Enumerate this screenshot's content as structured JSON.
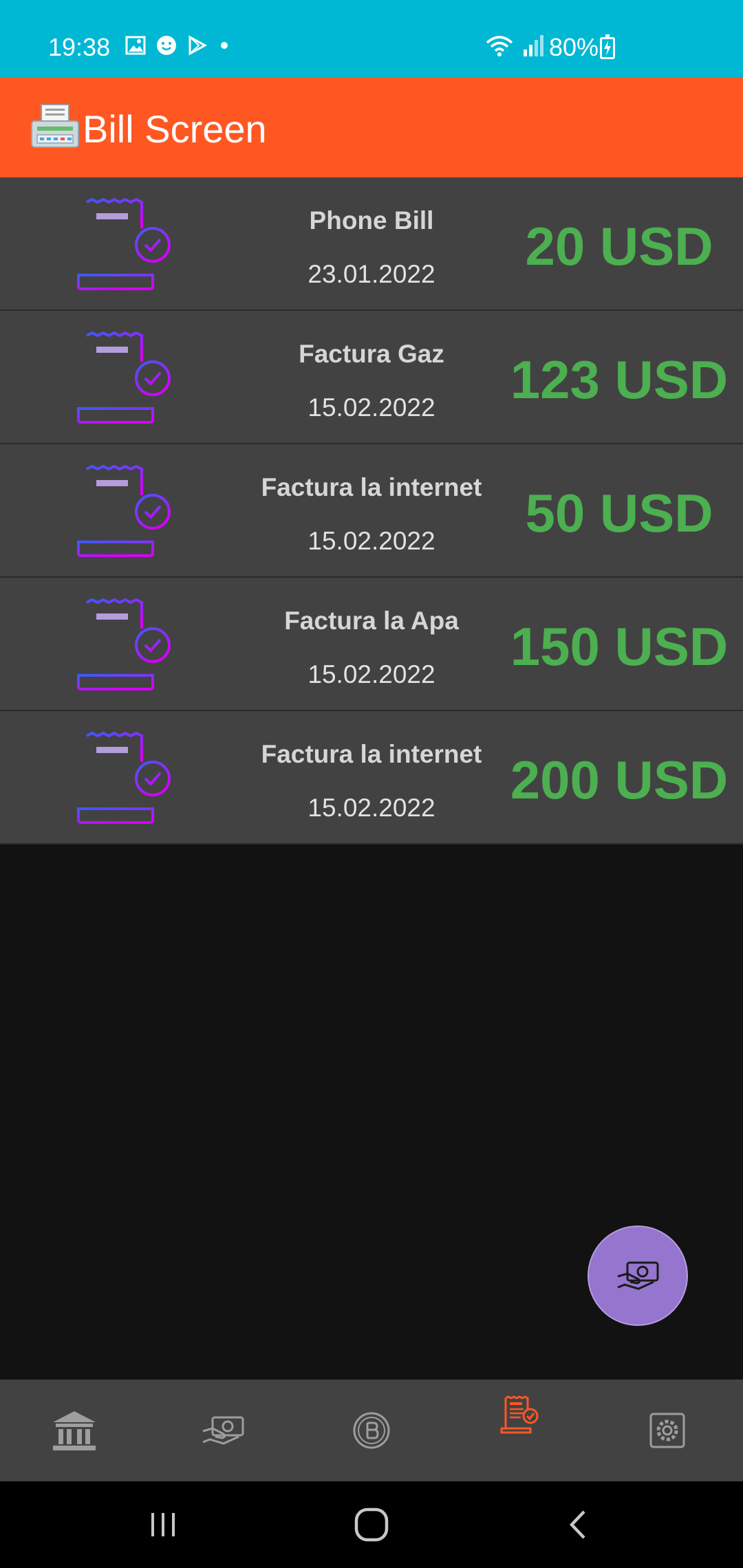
{
  "status_bar": {
    "time": "19:38",
    "battery": "80%",
    "icons": [
      "image-icon",
      "face-icon",
      "play-store-icon",
      "dot-icon",
      "wifi-icon",
      "signal-icon",
      "battery-charging-icon"
    ]
  },
  "app_bar": {
    "title": "Bill Screen",
    "icon": "printer-icon",
    "color": "#FF5722"
  },
  "bills": [
    {
      "name": "Phone Bill",
      "date": "23.01.2022",
      "amount": "20 USD"
    },
    {
      "name": "Factura Gaz",
      "date": "15.02.2022",
      "amount": "123 USD"
    },
    {
      "name": "Factura la internet",
      "date": "15.02.2022",
      "amount": "50 USD"
    },
    {
      "name": "Factura la Apa",
      "date": "15.02.2022",
      "amount": "150 USD"
    },
    {
      "name": "Factura la internet",
      "date": "15.02.2022",
      "amount": "200 USD"
    }
  ],
  "fab": {
    "icon": "money-hand-icon",
    "color": "#9575CD"
  },
  "bottom_nav": [
    {
      "icon": "bank-icon",
      "active": false
    },
    {
      "icon": "money-icon",
      "active": false
    },
    {
      "icon": "bitcoin-icon",
      "active": false
    },
    {
      "icon": "bill-icon",
      "active": true
    },
    {
      "icon": "settings-icon",
      "active": false
    }
  ],
  "colors": {
    "status_bar": "#00B8D4",
    "amount": "#4CAF50",
    "card": "#424242",
    "background": "#121212",
    "active_nav": "#FF5722"
  }
}
